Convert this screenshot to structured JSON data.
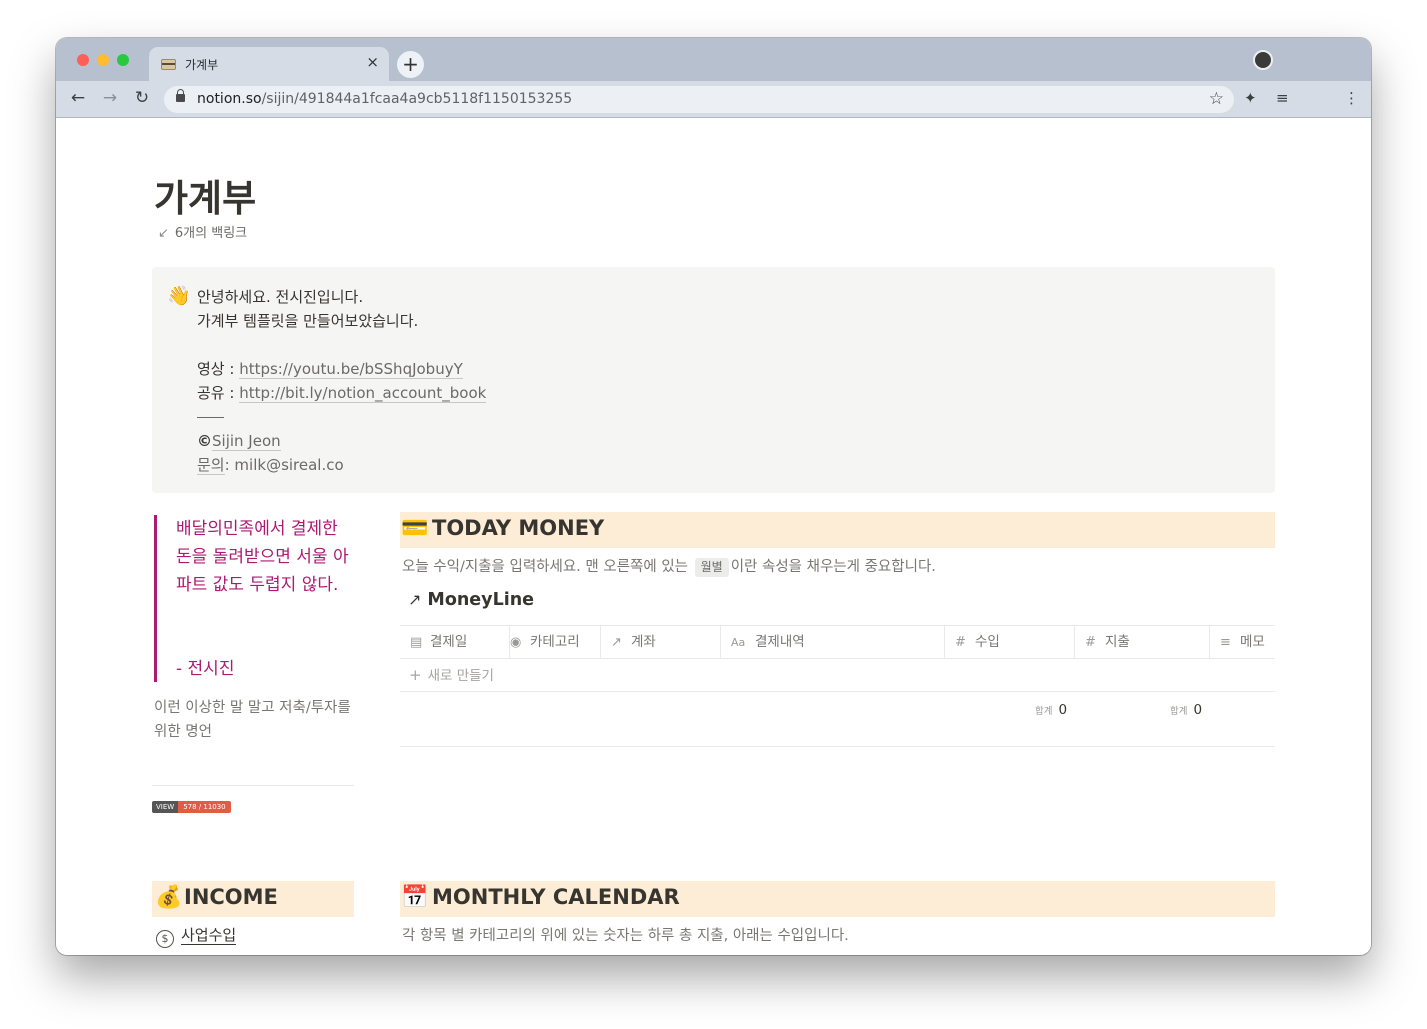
{
  "browser": {
    "tab_title": "가계부",
    "new_tab_label": "+",
    "close_label": "×",
    "url_host": "notion.so",
    "url_path": "/sijin/491844a1fcaa4a9cb5118f1150153255",
    "back_icon": "←",
    "forward_icon": "→",
    "reload_icon": "↻",
    "star_icon": "☆",
    "extensions_icon": "✦",
    "media_icon": "≡",
    "menu_icon": "⋮"
  },
  "page": {
    "title": "가계부",
    "backlinks_icon": "↙",
    "backlinks": "6개의 백링크"
  },
  "callout": {
    "emoji": "👋",
    "greeting": "안녕하세요. 전시진입니다.",
    "intro": "가계부 템플릿을 만들어보았습니다.",
    "video_label": "영상 : ",
    "video_link": "https://youtu.be/bSShqJobuyY",
    "share_label": "공유 : ",
    "share_link": "http://bit.ly/notion_account_book",
    "copyright_symbol": "©",
    "author": "Sijin Jeon",
    "contact_label": "문의",
    "contact_value": ": milk@sireal.co"
  },
  "quote": {
    "text": "배달의민족에서 결제한 돈을 돌려받으면 서울 아파트 값도 두렵지 않다.",
    "author": "- 전시진",
    "caption": "이런 이상한 말 말고 저축/투자를 위한 명언"
  },
  "view_badge": {
    "label": "VIEW",
    "value": "578 / 11030"
  },
  "today": {
    "emoji": "💳",
    "heading": "TODAY MONEY",
    "desc_before": "오늘 수익/지출을 입력하세요. 맨 오른쪽에 있는 ",
    "desc_code": "월별",
    "desc_after": "이란 속성을 채우는게 중요합니다."
  },
  "database": {
    "arrow": "↗",
    "title": "MoneyLine",
    "columns": [
      {
        "icon": "▤",
        "label": "결제일"
      },
      {
        "icon": "◉",
        "label": "카테고리"
      },
      {
        "icon": "↗",
        "label": "계좌"
      },
      {
        "icon": "Aa",
        "label": "결제내역"
      },
      {
        "icon": "#",
        "label": "수입"
      },
      {
        "icon": "#",
        "label": "지출"
      },
      {
        "icon": "≡",
        "label": "메모"
      }
    ],
    "new_row_plus": "+",
    "new_row_label": "새로 만들기",
    "sum_label": "합계",
    "income_sum": "0",
    "expense_sum": "0"
  },
  "income": {
    "emoji": "💰",
    "heading": "INCOME",
    "item_icon": "$",
    "item_label": "사업수입"
  },
  "monthly": {
    "emoji": "📅",
    "heading": "MONTHLY CALENDAR",
    "desc": "각 항목 별 카테고리의 위에 있는 숫자는 하루 총 지출, 아래는 수입입니다."
  }
}
